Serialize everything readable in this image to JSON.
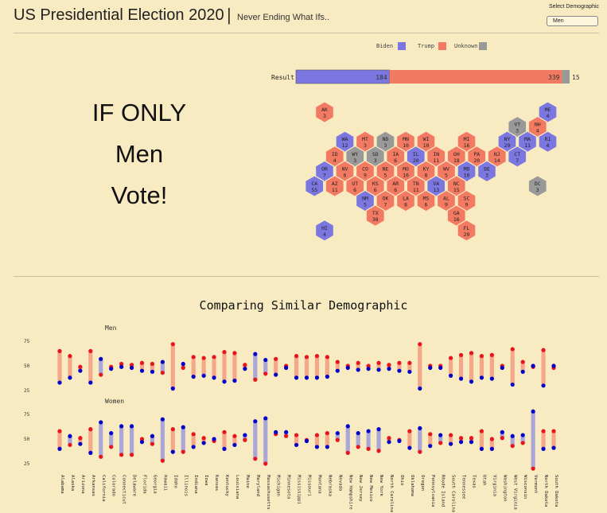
{
  "header": {
    "title": "US Presidential Election 2020",
    "separator": "|",
    "subtitle": "Never Ending What Ifs..",
    "select_label": "Select Demographic",
    "select_value": "Men"
  },
  "headline": {
    "line1": "IF ONLY",
    "line2": "Men",
    "line3": "Vote!"
  },
  "legend": [
    {
      "name": "Biden",
      "color": "#7b76e0"
    },
    {
      "name": "Trump",
      "color": "#f37a62"
    },
    {
      "name": "Unknown",
      "color": "#999999"
    }
  ],
  "result": {
    "label": "Result",
    "biden": 184,
    "trump": 339,
    "unknown": 15
  },
  "colors": {
    "biden": "#7b76e0",
    "trump": "#f37a62",
    "unknown": "#999999",
    "dot_biden": "#0000cc",
    "dot_trump": "#e8141c",
    "bar_trump": "#f5a889",
    "bar_biden": "#aaa6d8"
  },
  "map_states": [
    {
      "abbr": "AK",
      "ev": 3,
      "party": "trump"
    },
    {
      "abbr": "ME",
      "ev": 4,
      "party": "biden"
    },
    {
      "abbr": "VT",
      "ev": 3,
      "party": "unknown"
    },
    {
      "abbr": "NH",
      "ev": 4,
      "party": "trump"
    },
    {
      "abbr": "WA",
      "ev": 12,
      "party": "biden"
    },
    {
      "abbr": "MT",
      "ev": 3,
      "party": "trump"
    },
    {
      "abbr": "ND",
      "ev": 3,
      "party": "unknown"
    },
    {
      "abbr": "MN",
      "ev": 10,
      "party": "trump"
    },
    {
      "abbr": "WI",
      "ev": 10,
      "party": "trump"
    },
    {
      "abbr": "MI",
      "ev": 16,
      "party": "trump"
    },
    {
      "abbr": "NY",
      "ev": 29,
      "party": "biden"
    },
    {
      "abbr": "MA",
      "ev": 11,
      "party": "biden"
    },
    {
      "abbr": "RI",
      "ev": 4,
      "party": "biden"
    },
    {
      "abbr": "ID",
      "ev": 4,
      "party": "trump"
    },
    {
      "abbr": "WY",
      "ev": 3,
      "party": "unknown"
    },
    {
      "abbr": "SD",
      "ev": 3,
      "party": "unknown"
    },
    {
      "abbr": "IA",
      "ev": 6,
      "party": "trump"
    },
    {
      "abbr": "IL",
      "ev": 20,
      "party": "biden"
    },
    {
      "abbr": "IN",
      "ev": 11,
      "party": "trump"
    },
    {
      "abbr": "OH",
      "ev": 18,
      "party": "trump"
    },
    {
      "abbr": "PA",
      "ev": 20,
      "party": "trump"
    },
    {
      "abbr": "NJ",
      "ev": 14,
      "party": "trump"
    },
    {
      "abbr": "CT",
      "ev": 7,
      "party": "biden"
    },
    {
      "abbr": "OR",
      "ev": 7,
      "party": "biden"
    },
    {
      "abbr": "NV",
      "ev": 6,
      "party": "trump"
    },
    {
      "abbr": "CO",
      "ev": 9,
      "party": "trump"
    },
    {
      "abbr": "NE",
      "ev": 5,
      "party": "trump"
    },
    {
      "abbr": "MO",
      "ev": 10,
      "party": "trump"
    },
    {
      "abbr": "KY",
      "ev": 8,
      "party": "trump"
    },
    {
      "abbr": "WV",
      "ev": 5,
      "party": "trump"
    },
    {
      "abbr": "MD",
      "ev": 10,
      "party": "biden"
    },
    {
      "abbr": "DE",
      "ev": 3,
      "party": "biden"
    },
    {
      "abbr": "CA",
      "ev": 55,
      "party": "biden"
    },
    {
      "abbr": "AZ",
      "ev": 11,
      "party": "trump"
    },
    {
      "abbr": "UT",
      "ev": 6,
      "party": "trump"
    },
    {
      "abbr": "KS",
      "ev": 6,
      "party": "trump"
    },
    {
      "abbr": "AR",
      "ev": 6,
      "party": "trump"
    },
    {
      "abbr": "TN",
      "ev": 11,
      "party": "trump"
    },
    {
      "abbr": "VA",
      "ev": 13,
      "party": "biden"
    },
    {
      "abbr": "NC",
      "ev": 15,
      "party": "trump"
    },
    {
      "abbr": "DC",
      "ev": 3,
      "party": "unknown"
    },
    {
      "abbr": "NM",
      "ev": 5,
      "party": "biden"
    },
    {
      "abbr": "OK",
      "ev": 7,
      "party": "trump"
    },
    {
      "abbr": "LA",
      "ev": 8,
      "party": "trump"
    },
    {
      "abbr": "MS",
      "ev": 6,
      "party": "trump"
    },
    {
      "abbr": "AL",
      "ev": 9,
      "party": "trump"
    },
    {
      "abbr": "SC",
      "ev": 9,
      "party": "trump"
    },
    {
      "abbr": "TX",
      "ev": 38,
      "party": "trump"
    },
    {
      "abbr": "GA",
      "ev": 16,
      "party": "trump"
    },
    {
      "abbr": "HI",
      "ev": 4,
      "party": "biden"
    },
    {
      "abbr": "FL",
      "ev": 29,
      "party": "trump"
    }
  ],
  "chart_data": {
    "type": "dumbbell",
    "title": "Comparing Similar Demographic",
    "ylim": [
      15,
      80
    ],
    "yticks": [
      25,
      50,
      75
    ],
    "states": [
      "Alabama",
      "Alaska",
      "Arizona",
      "Arkansas",
      "California",
      "Colorado",
      "Connecticut",
      "Delaware",
      "Florida",
      "Georgia",
      "Hawaii",
      "Idaho",
      "Illinois",
      "Indiana",
      "Iowa",
      "Kansas",
      "Kentucky",
      "Louisiana",
      "Maine",
      "Maryland",
      "Massachusetts",
      "Michigan",
      "Minnesota",
      "Mississippi",
      "Missouri",
      "Montana",
      "Nebraska",
      "Nevada",
      "New Hampshire",
      "New Jersey",
      "New Mexico",
      "New York",
      "North Carolina",
      "Ohio",
      "Oklahoma",
      "Oregon",
      "Pennsylvania",
      "Rhode Island",
      "South Carolina",
      "Tennessee",
      "Texas",
      "Utah",
      "Virginia",
      "Washington",
      "West Virginia",
      "Wisconsin",
      "Vermont",
      "North Dakota",
      "South Dakota"
    ],
    "panels": [
      {
        "name": "Men",
        "trump": [
          65,
          60,
          49,
          65,
          41,
          49,
          52,
          51,
          53,
          52,
          43,
          72,
          48,
          59,
          58,
          59,
          64,
          63,
          51,
          36,
          42,
          57,
          50,
          60,
          59,
          60,
          59,
          54,
          50,
          53,
          50,
          53,
          51,
          53,
          53,
          72,
          50,
          50,
          58,
          61,
          63,
          60,
          61,
          50,
          67,
          54,
          49,
          66,
          48
        ],
        "biden": [
          33,
          38,
          45,
          33,
          57,
          47,
          49,
          48,
          45,
          44,
          54,
          27,
          52,
          39,
          40,
          38,
          34,
          35,
          47,
          62,
          56,
          41,
          48,
          38,
          38,
          38,
          39,
          45,
          48,
          46,
          47,
          46,
          47,
          45,
          44,
          27,
          48,
          48,
          40,
          37,
          34,
          38,
          37,
          48,
          31,
          44,
          50,
          30,
          50
        ]
      },
      {
        "name": "Women",
        "trump": [
          58,
          44,
          51,
          60,
          32,
          42,
          34,
          34,
          50,
          45,
          28,
          60,
          37,
          55,
          51,
          48,
          57,
          53,
          49,
          30,
          25,
          55,
          53,
          54,
          49,
          54,
          56,
          49,
          36,
          42,
          40,
          38,
          51,
          49,
          58,
          37,
          55,
          46,
          54,
          51,
          51,
          58,
          50,
          51,
          43,
          46,
          20,
          58,
          58
        ],
        "biden": [
          40,
          53,
          45,
          36,
          67,
          56,
          63,
          63,
          47,
          53,
          70,
          37,
          62,
          42,
          46,
          50,
          40,
          44,
          54,
          68,
          71,
          57,
          57,
          44,
          48,
          42,
          42,
          56,
          63,
          56,
          58,
          60,
          47,
          48,
          41,
          61,
          43,
          54,
          45,
          47,
          47,
          40,
          40,
          57,
          53,
          54,
          78,
          40,
          41
        ]
      }
    ]
  }
}
